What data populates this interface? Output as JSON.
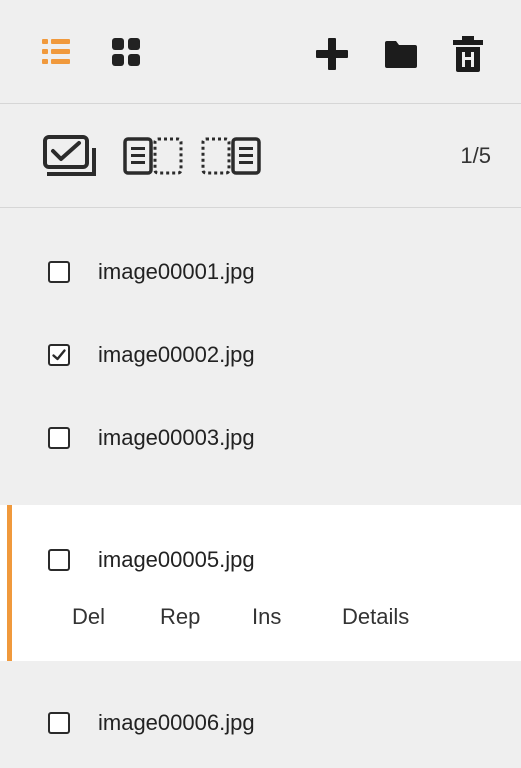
{
  "toolbar": {
    "icons": [
      "list-view-icon",
      "grid-view-icon",
      "add-icon",
      "folder-icon",
      "trash-icon"
    ],
    "accent_color": "#f0993c"
  },
  "selection": {
    "icons": [
      "select-all-icon",
      "select-before-icon",
      "select-after-icon"
    ],
    "counter": "1/5"
  },
  "files": [
    {
      "name": "image00001.jpg",
      "checked": false
    },
    {
      "name": "image00002.jpg",
      "checked": true
    },
    {
      "name": "image00003.jpg",
      "checked": false
    },
    {
      "name": "image00005.jpg",
      "checked": false
    },
    {
      "name": "image00006.jpg",
      "checked": false
    }
  ],
  "actions": {
    "delete": "Del",
    "replace": "Rep",
    "insert": "Ins",
    "details": "Details"
  }
}
